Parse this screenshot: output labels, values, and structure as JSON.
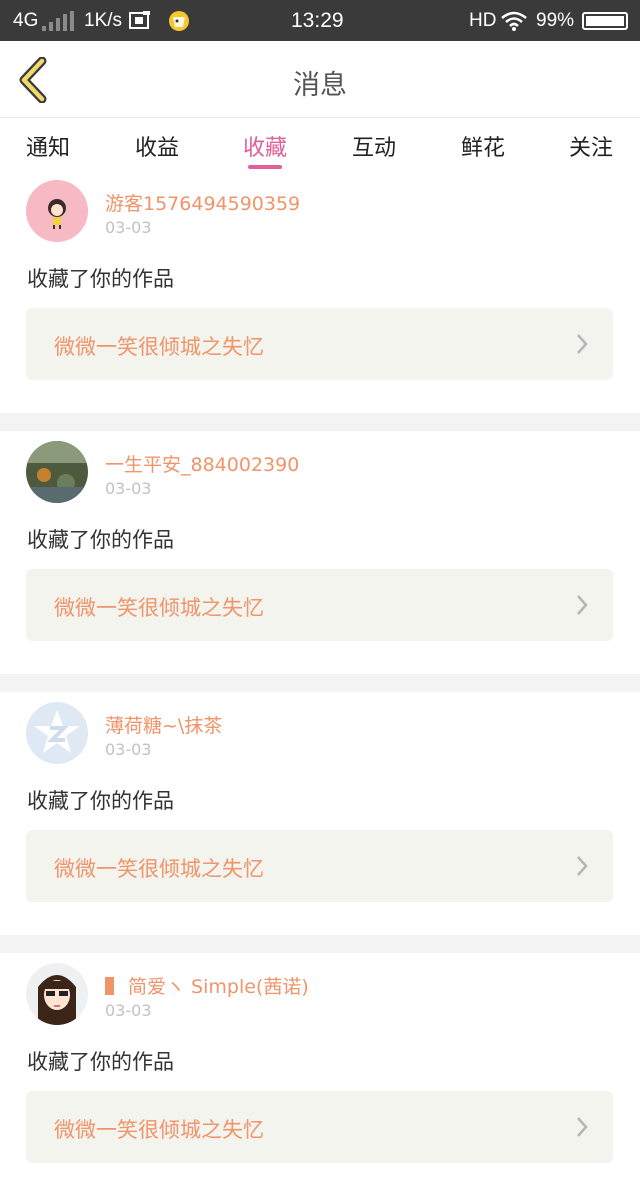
{
  "status_bar": {
    "network": "4G",
    "speed": "1K/s",
    "time": "13:29",
    "hd": "HD",
    "battery": "99%"
  },
  "nav": {
    "title": "消息"
  },
  "tabs": [
    {
      "label": "通知",
      "active": false
    },
    {
      "label": "收益",
      "active": false
    },
    {
      "label": "收藏",
      "active": true
    },
    {
      "label": "互动",
      "active": false
    },
    {
      "label": "鲜花",
      "active": false
    },
    {
      "label": "关注",
      "active": false
    }
  ],
  "colors": {
    "accent": "#e0609a",
    "name": "#f0946a",
    "box": "#f4f4ef"
  },
  "messages": [
    {
      "username": "游客1576494590359",
      "date": "03-03",
      "action": "收藏了你的作品",
      "work": "微微一笑很倾城之失忆",
      "avatar": "cartoon-girl-avatar"
    },
    {
      "username": "一生平安_884002390",
      "date": "03-03",
      "action": "收藏了你的作品",
      "work": "微微一笑很倾城之失忆",
      "avatar": "landscape-avatar"
    },
    {
      "username": "薄荷糖~\\抹茶",
      "date": "03-03",
      "action": "收藏了你的作品",
      "work": "微微一笑很倾城之失忆",
      "avatar": "default-star-avatar"
    },
    {
      "username": "简爱ヽ Simple(茜诺)",
      "date": "03-03",
      "action": "收藏了你的作品",
      "work": "微微一笑很倾城之失忆",
      "avatar": "doll-girl-avatar"
    }
  ]
}
